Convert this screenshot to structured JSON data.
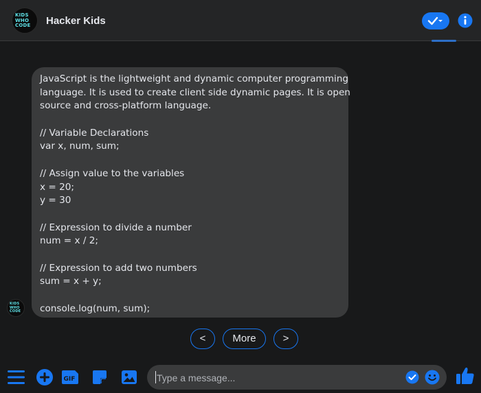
{
  "header": {
    "title": "Hacker Kids",
    "logo_text": "KIDS WHO CODE"
  },
  "message": {
    "lines": [
      "JavaScript is the lightweight and dynamic computer programming",
      "language. It is used to create client side dynamic pages. It is open",
      "source and cross-platform language.",
      "",
      "// Variable Declarations",
      "var x, num, sum;",
      "",
      "// Assign value to the variables",
      "x = 20;",
      "y = 30",
      "",
      "// Expression to divide a number",
      "num = x / 2;",
      "",
      "// Expression to add two numbers",
      "sum = x + y;",
      "",
      "console.log(num, sum);"
    ]
  },
  "quick_replies": {
    "prev": "<",
    "more": "More",
    "next": ">"
  },
  "composer": {
    "placeholder": "Type a message..."
  },
  "colors": {
    "accent": "#1877f2",
    "bubble": "#3a3b3c",
    "background": "#18191a",
    "header": "#242526"
  },
  "icons": [
    "menu-icon",
    "add-icon",
    "gif-icon",
    "sticker-icon",
    "image-icon",
    "emoji-icon",
    "like-icon",
    "info-icon",
    "checkmark-icon"
  ]
}
